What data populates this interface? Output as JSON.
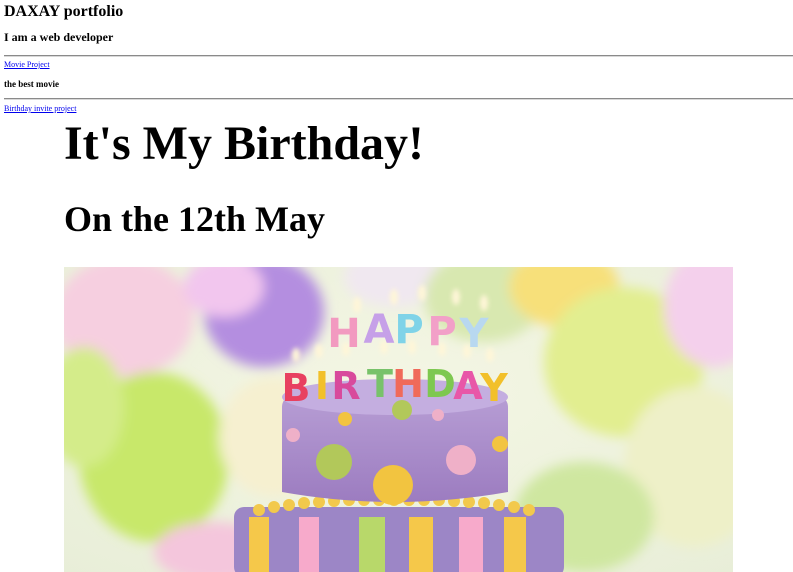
{
  "portfolio": {
    "title": "DAXAY portfolio",
    "tagline": "I am a web developer"
  },
  "projects": [
    {
      "link_text": "Movie Project",
      "description": "the best movie"
    },
    {
      "link_text": "Birthday invite project"
    }
  ],
  "invite": {
    "heading": "It's My Birthday!",
    "date_heading": "On the 12th May",
    "image": {
      "name": "birthday-cake-photo",
      "candle_letters_top": "HAPPY",
      "candle_letters_bottom": "BIRTHDAY"
    }
  },
  "colors": {
    "link": "#0000ee",
    "cake_purple": "#a88cc8",
    "balloon_green": "#c8e86a",
    "balloon_purple": "#b48ee0"
  }
}
